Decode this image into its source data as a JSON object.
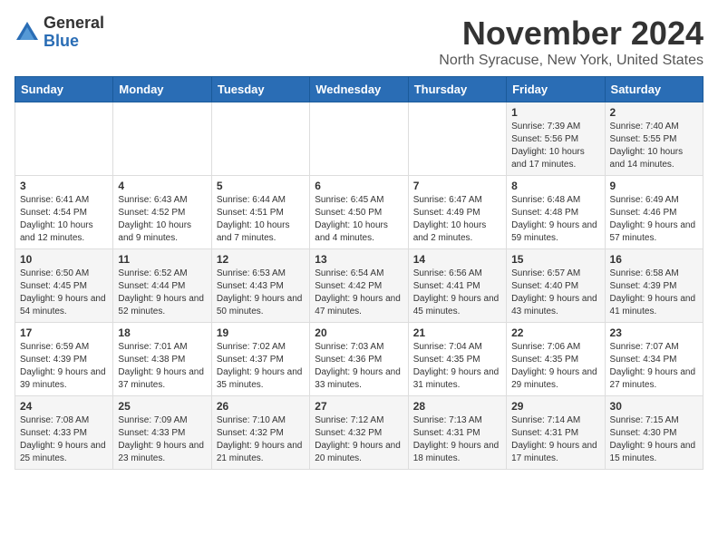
{
  "logo": {
    "general": "General",
    "blue": "Blue"
  },
  "title": "November 2024",
  "location": "North Syracuse, New York, United States",
  "days_of_week": [
    "Sunday",
    "Monday",
    "Tuesday",
    "Wednesday",
    "Thursday",
    "Friday",
    "Saturday"
  ],
  "weeks": [
    [
      {
        "day": "",
        "info": ""
      },
      {
        "day": "",
        "info": ""
      },
      {
        "day": "",
        "info": ""
      },
      {
        "day": "",
        "info": ""
      },
      {
        "day": "",
        "info": ""
      },
      {
        "day": "1",
        "info": "Sunrise: 7:39 AM\nSunset: 5:56 PM\nDaylight: 10 hours and 17 minutes."
      },
      {
        "day": "2",
        "info": "Sunrise: 7:40 AM\nSunset: 5:55 PM\nDaylight: 10 hours and 14 minutes."
      }
    ],
    [
      {
        "day": "3",
        "info": "Sunrise: 6:41 AM\nSunset: 4:54 PM\nDaylight: 10 hours and 12 minutes."
      },
      {
        "day": "4",
        "info": "Sunrise: 6:43 AM\nSunset: 4:52 PM\nDaylight: 10 hours and 9 minutes."
      },
      {
        "day": "5",
        "info": "Sunrise: 6:44 AM\nSunset: 4:51 PM\nDaylight: 10 hours and 7 minutes."
      },
      {
        "day": "6",
        "info": "Sunrise: 6:45 AM\nSunset: 4:50 PM\nDaylight: 10 hours and 4 minutes."
      },
      {
        "day": "7",
        "info": "Sunrise: 6:47 AM\nSunset: 4:49 PM\nDaylight: 10 hours and 2 minutes."
      },
      {
        "day": "8",
        "info": "Sunrise: 6:48 AM\nSunset: 4:48 PM\nDaylight: 9 hours and 59 minutes."
      },
      {
        "day": "9",
        "info": "Sunrise: 6:49 AM\nSunset: 4:46 PM\nDaylight: 9 hours and 57 minutes."
      }
    ],
    [
      {
        "day": "10",
        "info": "Sunrise: 6:50 AM\nSunset: 4:45 PM\nDaylight: 9 hours and 54 minutes."
      },
      {
        "day": "11",
        "info": "Sunrise: 6:52 AM\nSunset: 4:44 PM\nDaylight: 9 hours and 52 minutes."
      },
      {
        "day": "12",
        "info": "Sunrise: 6:53 AM\nSunset: 4:43 PM\nDaylight: 9 hours and 50 minutes."
      },
      {
        "day": "13",
        "info": "Sunrise: 6:54 AM\nSunset: 4:42 PM\nDaylight: 9 hours and 47 minutes."
      },
      {
        "day": "14",
        "info": "Sunrise: 6:56 AM\nSunset: 4:41 PM\nDaylight: 9 hours and 45 minutes."
      },
      {
        "day": "15",
        "info": "Sunrise: 6:57 AM\nSunset: 4:40 PM\nDaylight: 9 hours and 43 minutes."
      },
      {
        "day": "16",
        "info": "Sunrise: 6:58 AM\nSunset: 4:39 PM\nDaylight: 9 hours and 41 minutes."
      }
    ],
    [
      {
        "day": "17",
        "info": "Sunrise: 6:59 AM\nSunset: 4:39 PM\nDaylight: 9 hours and 39 minutes."
      },
      {
        "day": "18",
        "info": "Sunrise: 7:01 AM\nSunset: 4:38 PM\nDaylight: 9 hours and 37 minutes."
      },
      {
        "day": "19",
        "info": "Sunrise: 7:02 AM\nSunset: 4:37 PM\nDaylight: 9 hours and 35 minutes."
      },
      {
        "day": "20",
        "info": "Sunrise: 7:03 AM\nSunset: 4:36 PM\nDaylight: 9 hours and 33 minutes."
      },
      {
        "day": "21",
        "info": "Sunrise: 7:04 AM\nSunset: 4:35 PM\nDaylight: 9 hours and 31 minutes."
      },
      {
        "day": "22",
        "info": "Sunrise: 7:06 AM\nSunset: 4:35 PM\nDaylight: 9 hours and 29 minutes."
      },
      {
        "day": "23",
        "info": "Sunrise: 7:07 AM\nSunset: 4:34 PM\nDaylight: 9 hours and 27 minutes."
      }
    ],
    [
      {
        "day": "24",
        "info": "Sunrise: 7:08 AM\nSunset: 4:33 PM\nDaylight: 9 hours and 25 minutes."
      },
      {
        "day": "25",
        "info": "Sunrise: 7:09 AM\nSunset: 4:33 PM\nDaylight: 9 hours and 23 minutes."
      },
      {
        "day": "26",
        "info": "Sunrise: 7:10 AM\nSunset: 4:32 PM\nDaylight: 9 hours and 21 minutes."
      },
      {
        "day": "27",
        "info": "Sunrise: 7:12 AM\nSunset: 4:32 PM\nDaylight: 9 hours and 20 minutes."
      },
      {
        "day": "28",
        "info": "Sunrise: 7:13 AM\nSunset: 4:31 PM\nDaylight: 9 hours and 18 minutes."
      },
      {
        "day": "29",
        "info": "Sunrise: 7:14 AM\nSunset: 4:31 PM\nDaylight: 9 hours and 17 minutes."
      },
      {
        "day": "30",
        "info": "Sunrise: 7:15 AM\nSunset: 4:30 PM\nDaylight: 9 hours and 15 minutes."
      }
    ]
  ]
}
